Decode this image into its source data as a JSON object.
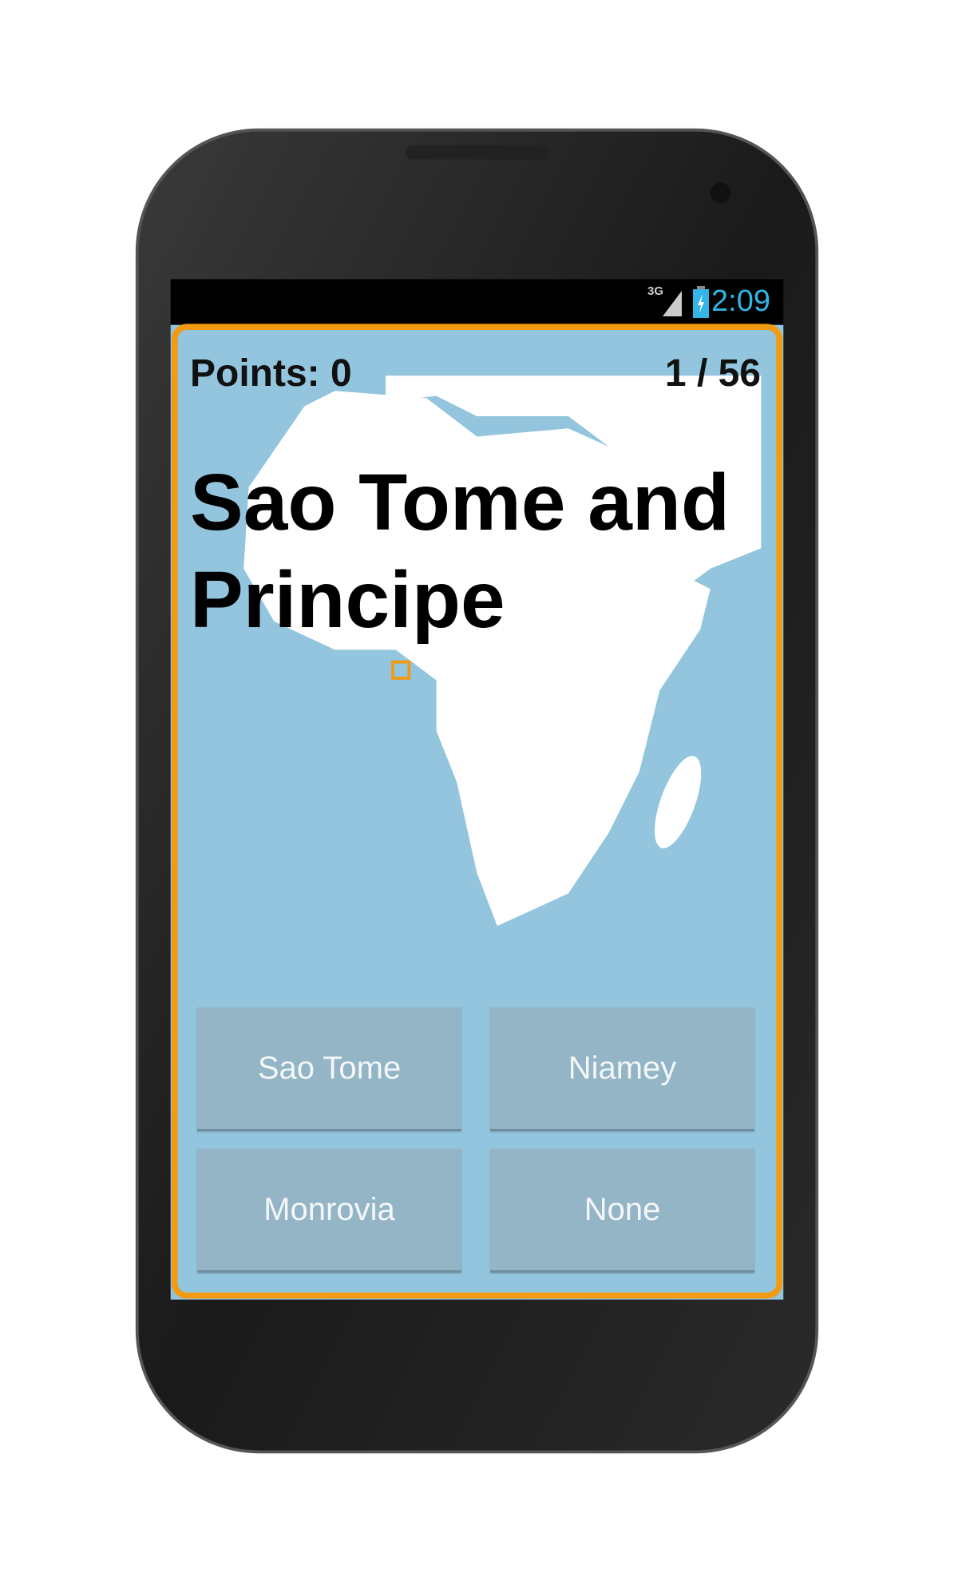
{
  "status_bar": {
    "network": "3G",
    "time": "2:09",
    "icons": [
      "signal-icon",
      "battery-charging-icon"
    ]
  },
  "quiz": {
    "points_label": "Points:  0",
    "progress": "1 / 56",
    "country": "Sao Tome and Principe",
    "answers": [
      "Sao Tome",
      "Niamey",
      "Monrovia",
      "None"
    ]
  },
  "colors": {
    "accent": "#f29a12",
    "sea": "#93c5de",
    "button": "#93b5c6",
    "clock": "#33b5e5"
  }
}
